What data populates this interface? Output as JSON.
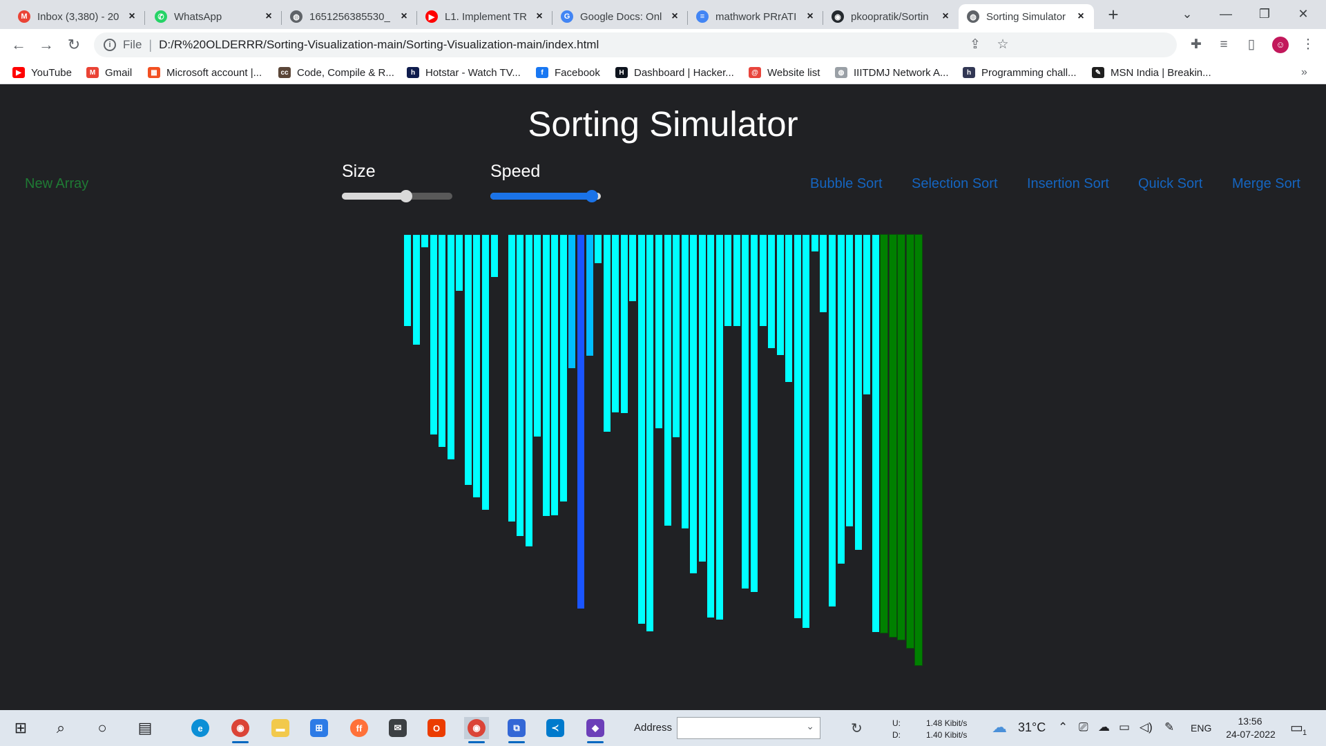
{
  "browser": {
    "tabs": [
      {
        "title": "Inbox (3,380) - 20",
        "icon": "gmail-icon",
        "color": "#ea4335",
        "glyph": "M"
      },
      {
        "title": "WhatsApp",
        "icon": "whatsapp-icon",
        "color": "#25d366",
        "glyph": "✆"
      },
      {
        "title": "1651256385530_",
        "icon": "globe-icon",
        "color": "#5f6368",
        "glyph": "◍"
      },
      {
        "title": "L1. Implement TR",
        "icon": "youtube-icon",
        "color": "#ff0000",
        "glyph": "▶"
      },
      {
        "title": "Google Docs: Onl",
        "icon": "google-icon",
        "color": "#4285f4",
        "glyph": "G"
      },
      {
        "title": "mathwork PRrATI",
        "icon": "docs-icon",
        "color": "#4285f4",
        "glyph": "≡"
      },
      {
        "title": "pkoopratik/Sortin",
        "icon": "github-icon",
        "color": "#24292e",
        "glyph": "◉"
      },
      {
        "title": "Sorting Simulator",
        "icon": "globe-icon",
        "color": "#5f6368",
        "glyph": "◍",
        "active": true
      }
    ],
    "new_tab": "+",
    "window_controls": {
      "minimize": "—",
      "restore": "❐",
      "close": "✕",
      "tab_search": "⌄"
    },
    "address": {
      "scheme": "File",
      "url": "D:/R%20OLDERRR/Sorting-Visualization-main/Sorting-Visualization-main/index.html"
    },
    "bookmarks": [
      {
        "label": "YouTube",
        "icon": "youtube-icon",
        "color": "#ff0000",
        "glyph": "▶"
      },
      {
        "label": "Gmail",
        "icon": "gmail-icon",
        "color": "#ea4335",
        "glyph": "M"
      },
      {
        "label": "Microsoft account |...",
        "icon": "microsoft-icon",
        "color": "#f25022",
        "glyph": "▦"
      },
      {
        "label": "Code, Compile & R...",
        "icon": "codechef-icon",
        "color": "#5b4638",
        "glyph": "cc"
      },
      {
        "label": "Hotstar - Watch TV...",
        "icon": "hotstar-icon",
        "color": "#0f1c4d",
        "glyph": "h"
      },
      {
        "label": "Facebook",
        "icon": "facebook-icon",
        "color": "#1877f2",
        "glyph": "f"
      },
      {
        "label": "Dashboard | Hacker...",
        "icon": "hackerrank-icon",
        "color": "#0e141e",
        "glyph": "H"
      },
      {
        "label": "Website list",
        "icon": "website-icon",
        "color": "#e8453c",
        "glyph": "@"
      },
      {
        "label": "IIITDMJ Network A...",
        "icon": "globe-icon",
        "color": "#9aa0a6",
        "glyph": "◍"
      },
      {
        "label": "Programming chall...",
        "icon": "hackerearth-icon",
        "color": "#323754",
        "glyph": "h"
      },
      {
        "label": "MSN India | Breakin...",
        "icon": "msn-icon",
        "color": "#1f1f1f",
        "glyph": "✎"
      }
    ],
    "bookmarks_overflow": "»"
  },
  "page": {
    "title": "Sorting Simulator",
    "new_array": "New Array",
    "size_label": "Size",
    "speed_label": "Speed",
    "size_value": 0.58,
    "speed_value": 0.92,
    "algorithms": [
      "Bubble Sort",
      "Selection Sort",
      "Insertion Sort",
      "Quick Sort",
      "Merge Sort"
    ],
    "colors": {
      "unsorted": "#00ffff",
      "comparing": "#00bfff",
      "active": "#1a55ff",
      "sorted": "#008000",
      "new_array": "#1f7a34",
      "algo": "#1565c0"
    }
  },
  "array": {
    "values": [
      132,
      159,
      18,
      289,
      307,
      325,
      81,
      362,
      380,
      398,
      61,
      0,
      415,
      436,
      451,
      292,
      407,
      406,
      386,
      193,
      541,
      175,
      41,
      285,
      257,
      258,
      96,
      563,
      574,
      280,
      421,
      293,
      425,
      490,
      473,
      554,
      557,
      132,
      132,
      512,
      517,
      132,
      164,
      174,
      213,
      555,
      569,
      24,
      112,
      538,
      476,
      422,
      456,
      231,
      575,
      576,
      582,
      586,
      598,
      623
    ],
    "states": [
      "u",
      "u",
      "u",
      "u",
      "u",
      "u",
      "u",
      "u",
      "u",
      "u",
      "u",
      "u",
      "u",
      "u",
      "u",
      "u",
      "u",
      "u",
      "u",
      "c",
      "a",
      "c",
      "u",
      "u",
      "u",
      "u",
      "u",
      "u",
      "u",
      "u",
      "u",
      "u",
      "u",
      "u",
      "u",
      "u",
      "u",
      "u",
      "u",
      "u",
      "u",
      "u",
      "u",
      "u",
      "u",
      "u",
      "u",
      "u",
      "u",
      "u",
      "u",
      "u",
      "u",
      "u",
      "u",
      "s",
      "s",
      "s",
      "s",
      "s"
    ],
    "max": 630
  },
  "taskbar": {
    "address_label": "Address",
    "net_upload_label": "U:",
    "net_download_label": "D:",
    "net_upload": "1.48 Kibit/s",
    "net_download": "1.40 Kibit/s",
    "temperature": "31°C",
    "language": "ENG",
    "time": "13:56",
    "date": "24-07-2022",
    "notifications": "1"
  }
}
